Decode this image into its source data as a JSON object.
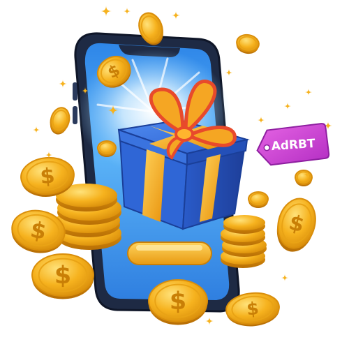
{
  "price_tag": {
    "label": "AdRBT"
  },
  "coin": {
    "symbol": "$",
    "icon": "dollar-coin-icon"
  },
  "colors": {
    "coin_gold": "#F6B21E",
    "coin_rim": "#D98E0B",
    "gift_box_blue": "#2F66D6",
    "ribbon_gold": "#F5A623",
    "bow_red": "#E84A2B",
    "phone_frame": "#1E2A44",
    "screen_blue": "#3C9AF0",
    "tag_pink": "#D43FD6"
  }
}
